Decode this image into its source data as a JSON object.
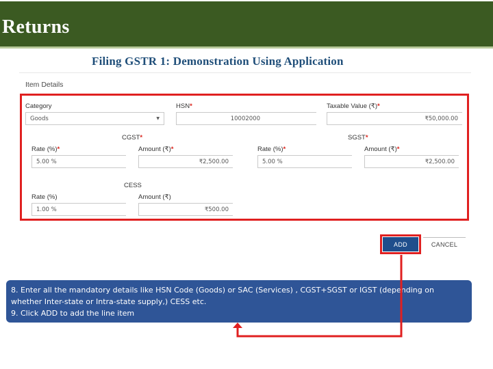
{
  "header": {
    "title": "Returns"
  },
  "subtitle": "Filing GSTR 1: Demonstration Using Application",
  "form": {
    "section_heading": "Item Details",
    "category": {
      "label": "Category",
      "value": "Goods"
    },
    "hsn": {
      "label": "HSN",
      "value": "10002000"
    },
    "taxable_value": {
      "label": "Taxable Value (₹)",
      "value": "₹50,000.00"
    },
    "cgst": {
      "heading": "CGST",
      "rate_label": "Rate (%)",
      "rate_value": "5.00 %",
      "amount_label": "Amount (₹)",
      "amount_value": "₹2,500.00"
    },
    "sgst": {
      "heading": "SGST",
      "rate_label": "Rate (%)",
      "rate_value": "5.00 %",
      "amount_label": "Amount (₹)",
      "amount_value": "₹2,500.00"
    },
    "cess": {
      "heading": "CESS",
      "rate_label": "Rate (%)",
      "rate_value": "1.00 %",
      "amount_label": "Amount (₹)",
      "amount_value": "₹500.00"
    },
    "required_marker": "*"
  },
  "buttons": {
    "add_label": "ADD",
    "cancel_label": "CANCEL"
  },
  "callout": {
    "line1": "8. Enter all the mandatory details like HSN Code (Goods) or SAC (Services) , CGST+SGST or IGST (depending on",
    "line2": "whether Inter-state or Intra-state supply,) CESS etc.",
    "line3": "9. Click ADD to add the line item"
  },
  "colors": {
    "header_bg": "#3b5a22",
    "highlight_red": "#e02020",
    "primary_button": "#1f4e8c",
    "callout_bg": "#2f5597"
  }
}
